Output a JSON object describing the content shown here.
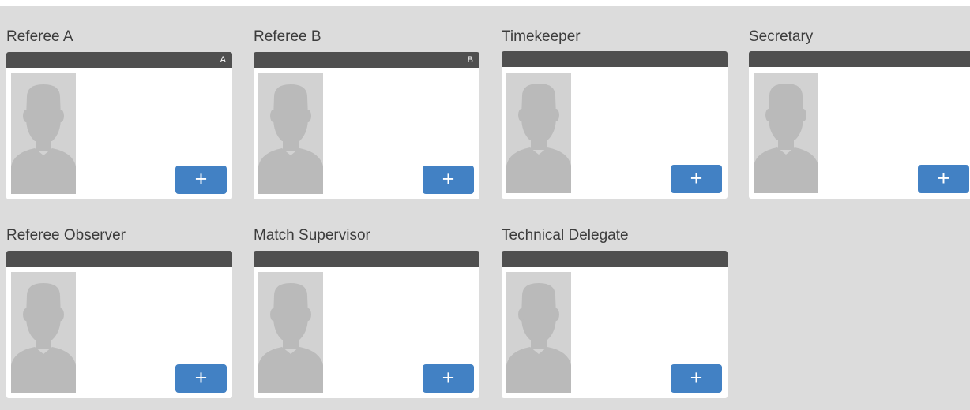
{
  "officials": [
    {
      "title": "Referee A",
      "header_letter": "A",
      "add_label": "+"
    },
    {
      "title": "Referee B",
      "header_letter": "B",
      "add_label": "+"
    },
    {
      "title": "Timekeeper",
      "header_letter": "",
      "add_label": "+"
    },
    {
      "title": "Secretary",
      "header_letter": "",
      "add_label": "+"
    },
    {
      "title": "Referee Observer",
      "header_letter": "",
      "add_label": "+"
    },
    {
      "title": "Match Supervisor",
      "header_letter": "",
      "add_label": "+"
    },
    {
      "title": "Technical Delegate",
      "header_letter": "",
      "add_label": "+"
    }
  ],
  "icons": {
    "avatar": "person-silhouette-icon",
    "add": "plus-icon"
  },
  "colors": {
    "page_background": "#dcdcdc",
    "card_header": "#4f4f4f",
    "card_body": "#ffffff",
    "add_button": "#4281c4",
    "avatar_background": "#d2d2d2",
    "avatar_silhouette": "#bababa"
  }
}
